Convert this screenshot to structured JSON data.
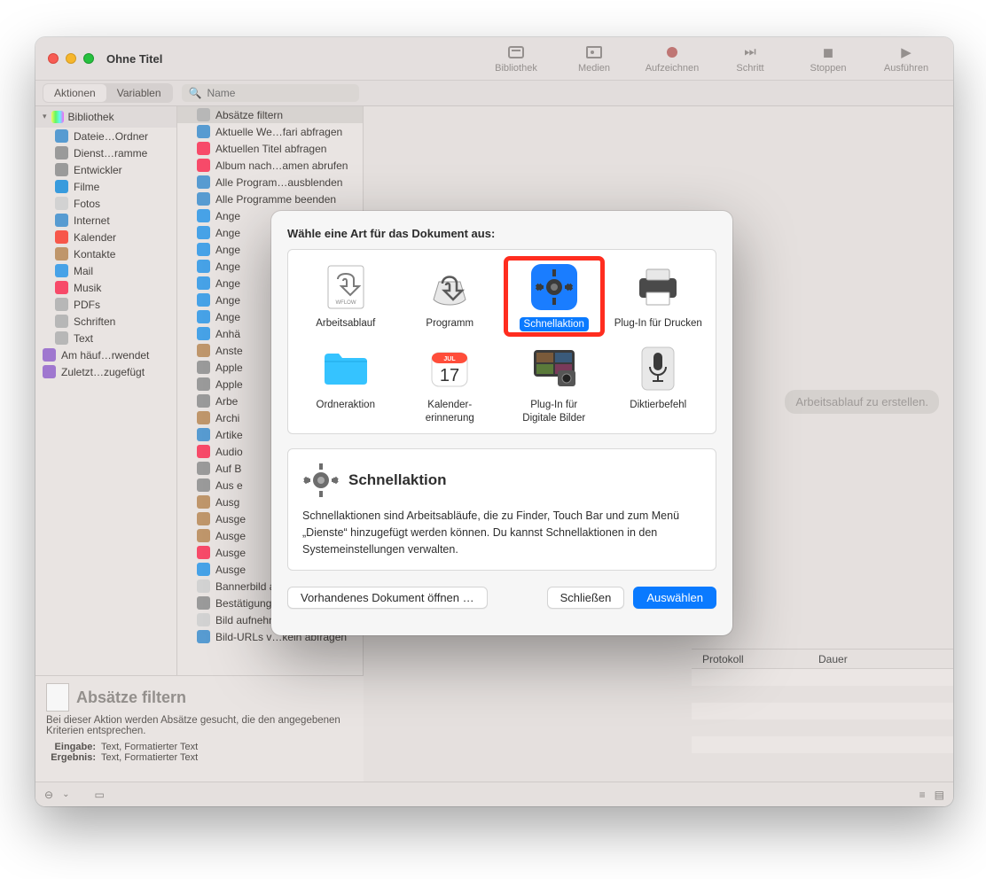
{
  "window_title": "Ohne Titel",
  "toolbar": [
    {
      "id": "library",
      "label": "Bibliothek"
    },
    {
      "id": "media",
      "label": "Medien"
    },
    {
      "id": "record",
      "label": "Aufzeichnen"
    },
    {
      "id": "step",
      "label": "Schritt"
    },
    {
      "id": "stop",
      "label": "Stoppen"
    },
    {
      "id": "run",
      "label": "Ausführen"
    }
  ],
  "tabs": {
    "actions": "Aktionen",
    "variables": "Variablen",
    "active": "actions"
  },
  "search_placeholder": "Name",
  "library": {
    "root": "Bibliothek",
    "items": [
      {
        "label": "Dateie…Ordner",
        "color": "#5aa0d8"
      },
      {
        "label": "Dienst…ramme",
        "color": "#9f9f9f"
      },
      {
        "label": "Entwickler",
        "color": "#9f9f9f"
      },
      {
        "label": "Filme",
        "color": "#3aa0e5"
      },
      {
        "label": "Fotos",
        "color": "#d9d9d9"
      },
      {
        "label": "Internet",
        "color": "#5aa0d8"
      },
      {
        "label": "Kalender",
        "color": "#ff5a4d"
      },
      {
        "label": "Kontakte",
        "color": "#c69b6f"
      },
      {
        "label": "Mail",
        "color": "#4aa8ef"
      },
      {
        "label": "Musik",
        "color": "#ff4d6d"
      },
      {
        "label": "PDFs",
        "color": "#bdbdbd"
      },
      {
        "label": "Schriften",
        "color": "#bdbdbd"
      },
      {
        "label": "Text",
        "color": "#bdbdbd"
      }
    ],
    "extra": [
      {
        "label": "Am häuf…rwendet",
        "color": "#a57bd6"
      },
      {
        "label": "Zuletzt…zugefügt",
        "color": "#a57bd6"
      }
    ]
  },
  "actions": [
    "Absätze filtern",
    "Aktuelle We…fari abfragen",
    "Aktuellen Titel abfragen",
    "Album nach…amen abrufen",
    "Alle Program…ausblenden",
    "Alle Programme beenden",
    "Ange",
    "Ange",
    "Ange",
    "Ange",
    "Ange",
    "Ange",
    "Ange",
    "Anhä",
    "Anste",
    "Apple",
    "Apple",
    "Arbe",
    "Archi",
    "Artike",
    "Audio",
    "Auf B",
    "Aus e",
    "Ausg",
    "Ausge",
    "Ausge",
    "Ausge",
    "Ausge",
    "Bannerbild a…ext erstellen",
    "Bestätigung verlangen",
    "Bild aufnehmen",
    "Bild-URLs v…keln abfragen"
  ],
  "action_icon_colors": [
    "#bdbdbd",
    "#5aa0d8",
    "#ff4d6d",
    "#ff4d6d",
    "#5aa0d8",
    "#5aa0d8",
    "#4aa8ef",
    "#4aa8ef",
    "#4aa8ef",
    "#4aa8ef",
    "#4aa8ef",
    "#4aa8ef",
    "#4aa8ef",
    "#4aa8ef",
    "#c69b6f",
    "#9f9f9f",
    "#9f9f9f",
    "#9f9f9f",
    "#c69b6f",
    "#5aa0d8",
    "#ff4d6d",
    "#9f9f9f",
    "#9f9f9f",
    "#c69b6f",
    "#c69b6f",
    "#c69b6f",
    "#ff4d6d",
    "#4aa8ef",
    "#d9d9d9",
    "#9f9f9f",
    "#d9d9d9",
    "#5aa0d8"
  ],
  "main_hint": "Arbeitsablauf zu erstellen.",
  "log": {
    "col1": "Protokoll",
    "col2": "Dauer"
  },
  "description": {
    "title": "Absätze filtern",
    "body": "Bei dieser Aktion werden Absätze gesucht, die den angegebenen Kriterien entsprechen.",
    "input_label": "Eingabe:",
    "input_value": "Text, Formatierter Text",
    "output_label": "Ergebnis:",
    "output_value": "Text, Formatierter Text"
  },
  "dialog": {
    "title": "Wähle eine Art für das Dokument aus:",
    "types": [
      {
        "id": "workflow",
        "label": "Arbeitsablauf"
      },
      {
        "id": "app",
        "label": "Programm"
      },
      {
        "id": "quick",
        "label": "Schnellaktion",
        "selected": true
      },
      {
        "id": "print",
        "label": "Plug-In für Drucken"
      },
      {
        "id": "folder",
        "label": "Ordneraktion"
      },
      {
        "id": "calendar",
        "label": "Kalender-\nerinnerung"
      },
      {
        "id": "image",
        "label": "Plug-In für\nDigitale Bilder"
      },
      {
        "id": "dictation",
        "label": "Diktierbefehl"
      }
    ],
    "explain_title": "Schnellaktion",
    "explain_body": "Schnellaktionen sind Arbeitsabläufe, die zu Finder, Touch Bar und zum Menü „Dienste“ hinzugefügt werden können. Du kannst Schnellaktionen in den Systemeinstellungen verwalten.",
    "open_existing": "Vorhandenes Dokument öffnen …",
    "close": "Schließen",
    "choose": "Auswählen"
  }
}
